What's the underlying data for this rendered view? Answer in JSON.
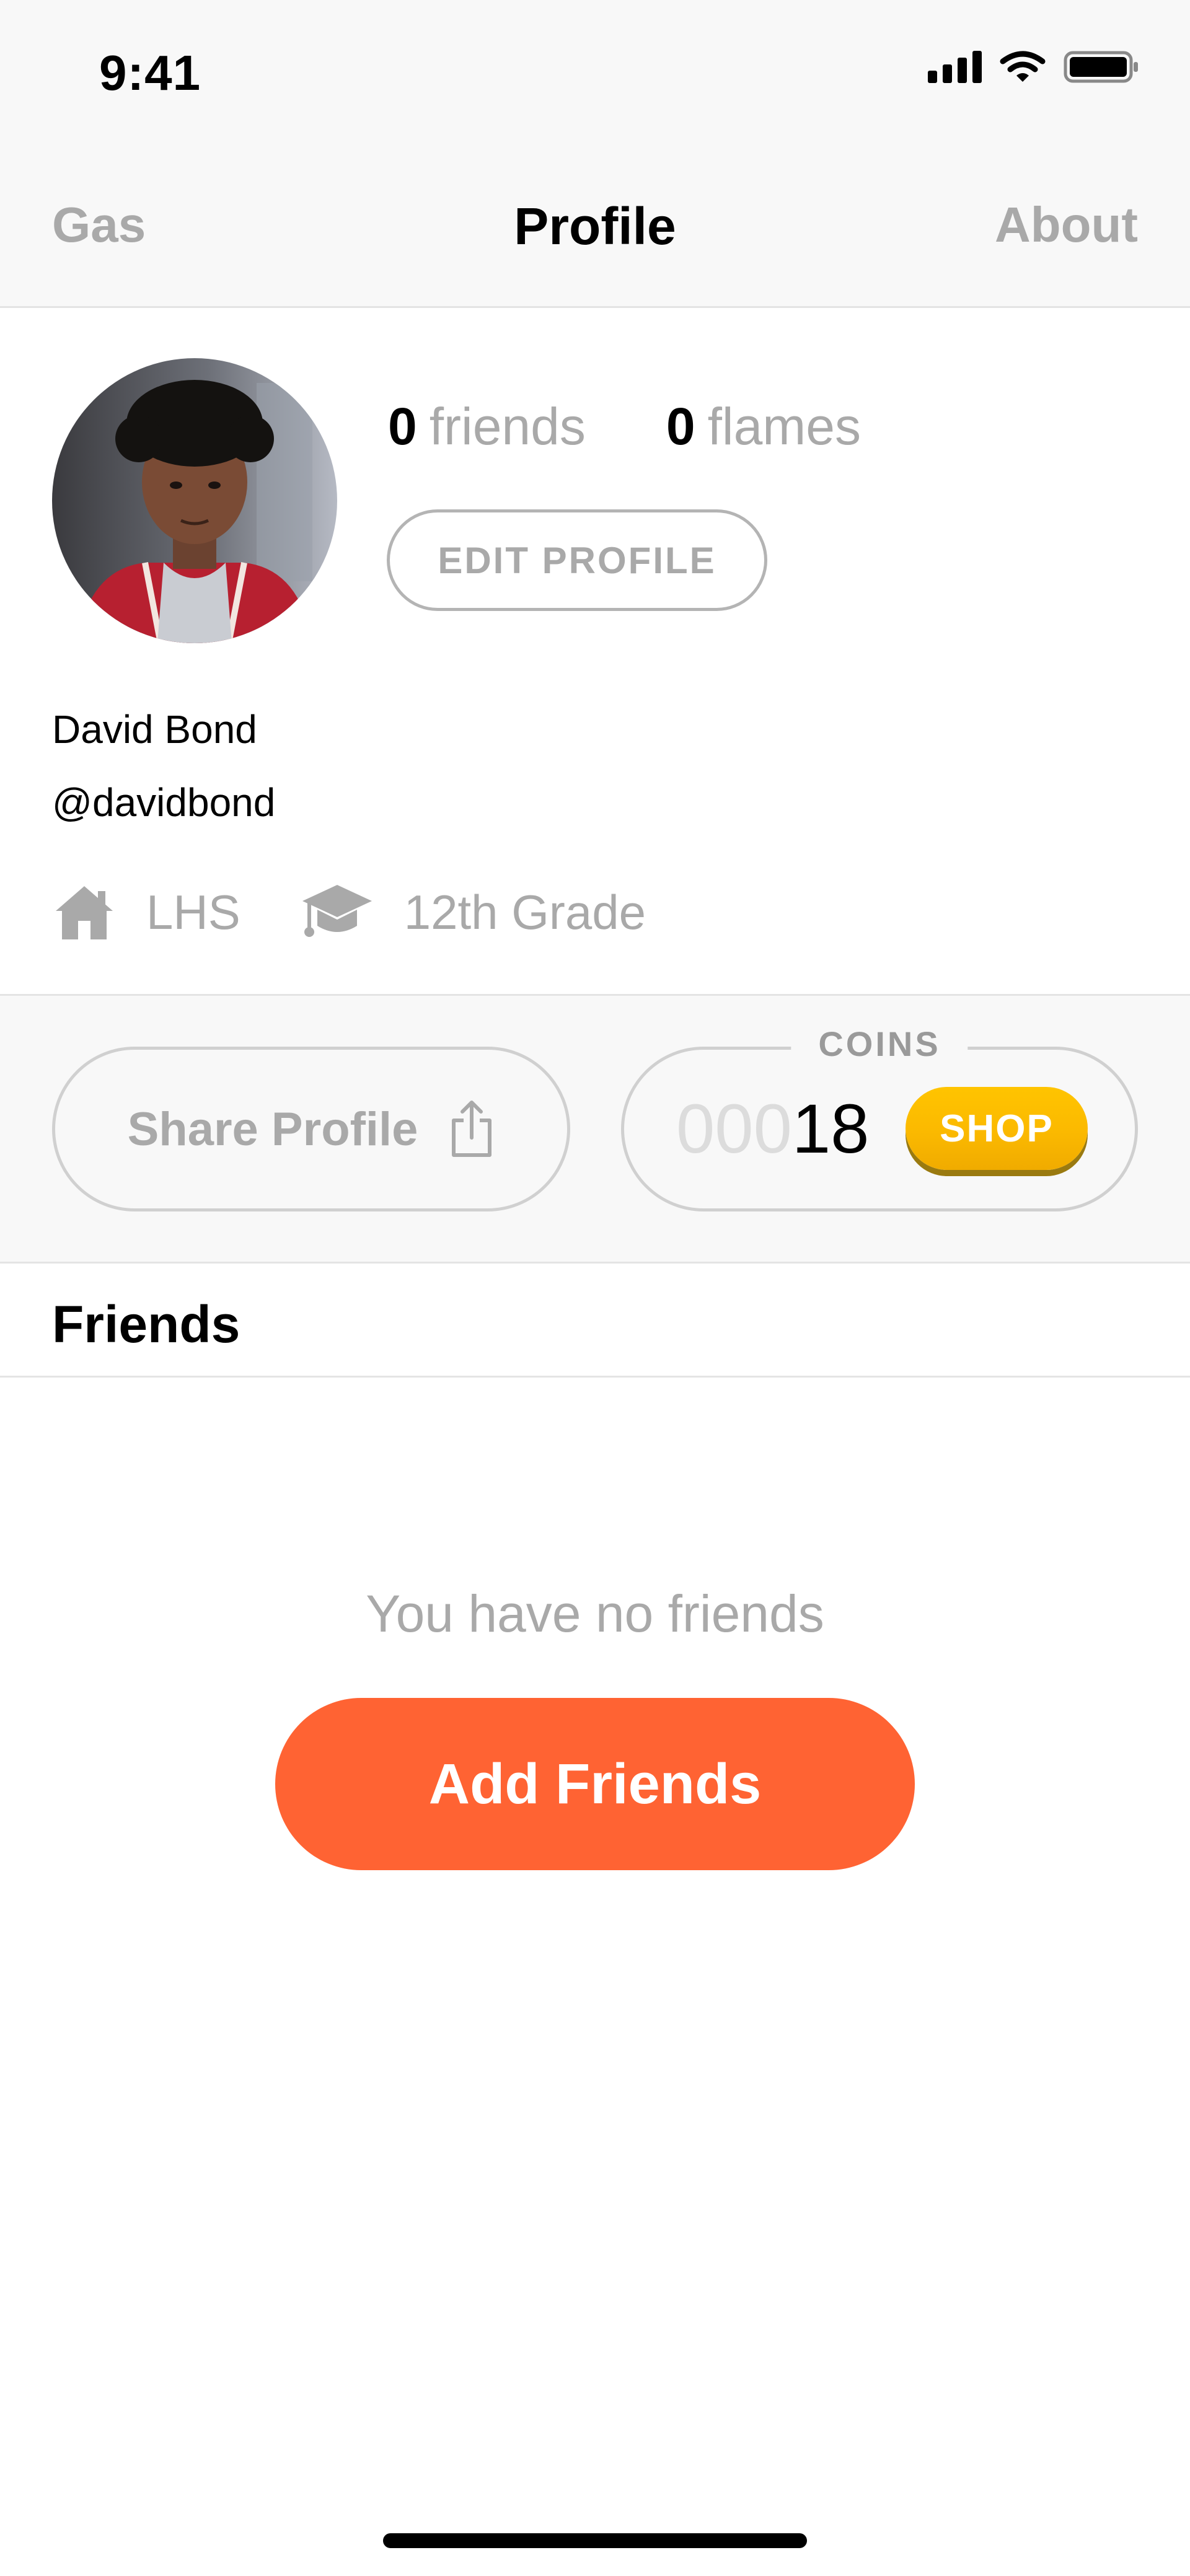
{
  "status_bar": {
    "time": "9:41"
  },
  "nav": {
    "left": "Gas",
    "title": "Profile",
    "right": "About"
  },
  "profile": {
    "friends_count": "0",
    "friends_label": "friends",
    "flames_count": "0",
    "flames_label": "flames",
    "edit_button": "EDIT PROFILE",
    "name": "David Bond",
    "handle": "@davidbond",
    "school": "LHS",
    "grade": "12th Grade"
  },
  "actions": {
    "share_label": "Share Profile",
    "coins_label": "COINS",
    "coins_pad": "000",
    "coins_value": "18",
    "shop_label": "SHOP"
  },
  "friends": {
    "title": "Friends",
    "empty_text": "You have no friends",
    "add_button": "Add Friends"
  },
  "icons": {
    "cellular": "cellular-signal-icon",
    "wifi": "wifi-icon",
    "battery": "battery-icon",
    "school": "home-icon",
    "grade": "graduation-cap-icon",
    "share": "share-icon"
  },
  "colors": {
    "accent": "#ff6333",
    "shop": "#fbb900",
    "muted_text": "#a9a9a9",
    "bar_bg": "#f8f8f8"
  }
}
